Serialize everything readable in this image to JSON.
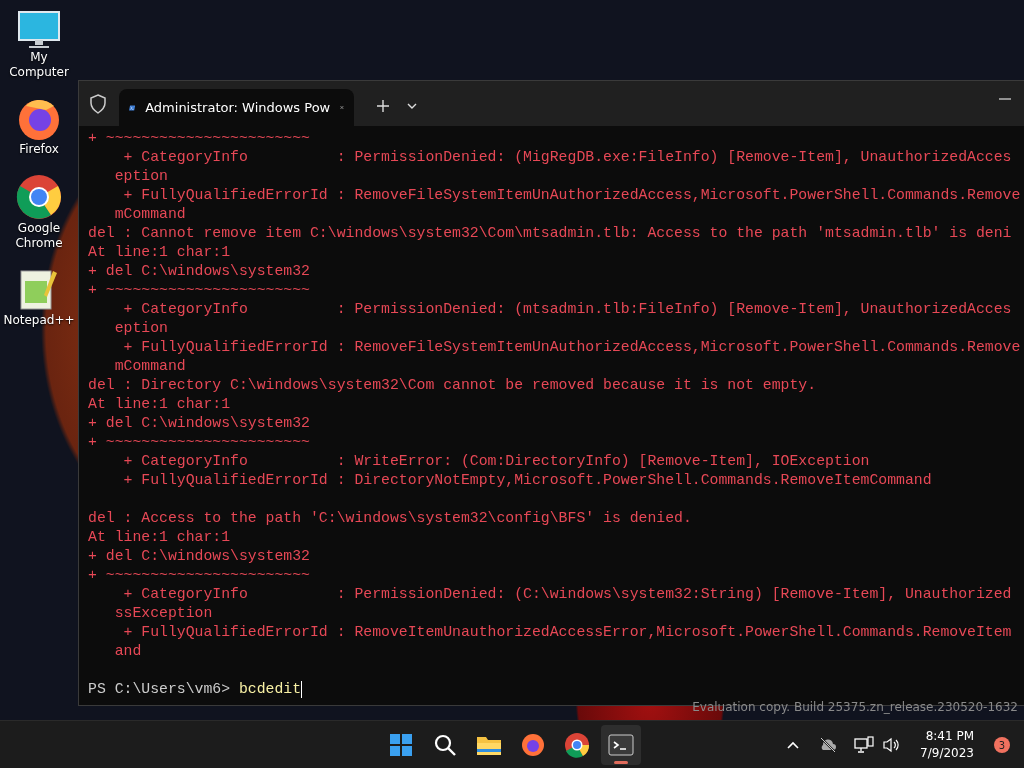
{
  "desktop_icons": [
    {
      "kind": "computer",
      "label": "My Computer"
    },
    {
      "kind": "firefox",
      "label": "Firefox"
    },
    {
      "kind": "chrome",
      "label": "Google Chrome"
    },
    {
      "kind": "notepad",
      "label": "Notepad++"
    }
  ],
  "window": {
    "tabs": [
      {
        "title": "Administrator: Windows Pow",
        "selected": true
      }
    ]
  },
  "terminal": {
    "lines": [
      {
        "kind": "error",
        "text": "+ ~~~~~~~~~~~~~~~~~~~~~~~"
      },
      {
        "kind": "error",
        "text": "    + CategoryInfo          : PermissionDenied: (MigRegDB.exe:FileInfo) [Remove-Item], UnauthorizedAcces"
      },
      {
        "kind": "error",
        "text": "   eption"
      },
      {
        "kind": "error",
        "text": "    + FullyQualifiedErrorId : RemoveFileSystemItemUnAuthorizedAccess,Microsoft.PowerShell.Commands.Remove"
      },
      {
        "kind": "error",
        "text": "   mCommand"
      },
      {
        "kind": "error",
        "text": "del : Cannot remove item C:\\windows\\system32\\Com\\mtsadmin.tlb: Access to the path 'mtsadmin.tlb' is deni"
      },
      {
        "kind": "error",
        "text": "At line:1 char:1"
      },
      {
        "kind": "error",
        "text": "+ del C:\\windows\\system32"
      },
      {
        "kind": "error",
        "text": "+ ~~~~~~~~~~~~~~~~~~~~~~~"
      },
      {
        "kind": "error",
        "text": "    + CategoryInfo          : PermissionDenied: (mtsadmin.tlb:FileInfo) [Remove-Item], UnauthorizedAcces"
      },
      {
        "kind": "error",
        "text": "   eption"
      },
      {
        "kind": "error",
        "text": "    + FullyQualifiedErrorId : RemoveFileSystemItemUnAuthorizedAccess,Microsoft.PowerShell.Commands.Remove"
      },
      {
        "kind": "error",
        "text": "   mCommand"
      },
      {
        "kind": "error",
        "text": "del : Directory C:\\windows\\system32\\Com cannot be removed because it is not empty."
      },
      {
        "kind": "error",
        "text": "At line:1 char:1"
      },
      {
        "kind": "error",
        "text": "+ del C:\\windows\\system32"
      },
      {
        "kind": "error",
        "text": "+ ~~~~~~~~~~~~~~~~~~~~~~~"
      },
      {
        "kind": "error",
        "text": "    + CategoryInfo          : WriteError: (Com:DirectoryInfo) [Remove-Item], IOException"
      },
      {
        "kind": "error",
        "text": "    + FullyQualifiedErrorId : DirectoryNotEmpty,Microsoft.PowerShell.Commands.RemoveItemCommand"
      },
      {
        "kind": "blank"
      },
      {
        "kind": "error",
        "text": "del : Access to the path 'C:\\windows\\system32\\config\\BFS' is denied."
      },
      {
        "kind": "error",
        "text": "At line:1 char:1"
      },
      {
        "kind": "error",
        "text": "+ del C:\\windows\\system32"
      },
      {
        "kind": "error",
        "text": "+ ~~~~~~~~~~~~~~~~~~~~~~~"
      },
      {
        "kind": "error",
        "text": "    + CategoryInfo          : PermissionDenied: (C:\\windows\\system32:String) [Remove-Item], Unauthorized"
      },
      {
        "kind": "error",
        "text": "   ssException"
      },
      {
        "kind": "error",
        "text": "    + FullyQualifiedErrorId : RemoveItemUnauthorizedAccessError,Microsoft.PowerShell.Commands.RemoveItem"
      },
      {
        "kind": "error",
        "text": "   and"
      },
      {
        "kind": "blank"
      }
    ],
    "prompt": {
      "text": "PS C:\\Users\\vm6> ",
      "command": "bcdedit"
    }
  },
  "desktop_build_text": "Evaluation copy. Build 25375.zn_release.230520-1632",
  "taskbar": {
    "apps": [
      {
        "kind": "start",
        "active": false
      },
      {
        "kind": "search",
        "active": false
      },
      {
        "kind": "explorer",
        "active": false
      },
      {
        "kind": "firefox",
        "active": false
      },
      {
        "kind": "chrome",
        "active": false
      },
      {
        "kind": "terminal",
        "active": true
      }
    ],
    "tray": {
      "time": "8:41 PM",
      "date": "7/9/2023",
      "notifications": "3"
    }
  }
}
